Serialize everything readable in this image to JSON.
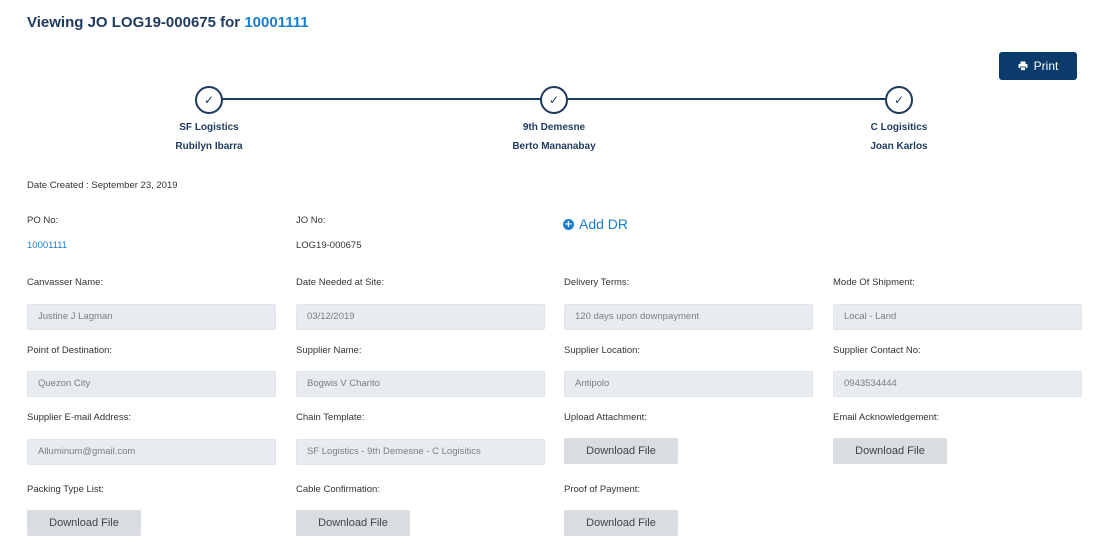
{
  "header": {
    "title_prefix": "Viewing JO LOG19-000675 for ",
    "title_po": "10001111",
    "print_label": "Print"
  },
  "chain": [
    {
      "company": "SF Logistics",
      "person": "Rubilyn Ibarra",
      "status_icon": "check-icon"
    },
    {
      "company": "9th Demesne",
      "person": "Berto Mananabay",
      "status_icon": "check-icon"
    },
    {
      "company": "C Logisitics",
      "person": "Joan Karlos",
      "status_icon": "check-icon"
    }
  ],
  "date_created": "Date Created : September 23, 2019",
  "po": {
    "label": "PO No:",
    "value": "10001111"
  },
  "jo": {
    "label": "JO No:",
    "value": "LOG19-000675"
  },
  "add_dr_label": "Add DR",
  "fields": {
    "canvasser": {
      "label": "Canvasser Name:",
      "value": "Justine J Lagman"
    },
    "date_needed": {
      "label": "Date Needed at Site:",
      "value": "03/12/2019"
    },
    "delivery_terms": {
      "label": "Delivery Terms:",
      "value": "120 days upon downpayment"
    },
    "mode_shipment": {
      "label": "Mode Of Shipment:",
      "value": "Local - Land"
    },
    "destination": {
      "label": "Point of Destination:",
      "value": "Quezon City"
    },
    "supplier_name": {
      "label": "Supplier Name:",
      "value": "Bogwis V Charito"
    },
    "supplier_location": {
      "label": "Supplier Location:",
      "value": "Antipolo"
    },
    "supplier_contact": {
      "label": "Supplier Contact No:",
      "value": "0943534444"
    },
    "supplier_email": {
      "label": "Supplier E-mail Address:",
      "value": "Alluminum@gmail.com"
    },
    "chain_template": {
      "label": "Chain Template:",
      "value": "SF Logistics - 9th Demesne - C Logisitics"
    },
    "upload_attachment": {
      "label": "Upload Attachment:",
      "button": "Download File"
    },
    "email_ack": {
      "label": "Email Acknowledgement:",
      "button": "Download File"
    },
    "packing_list": {
      "label": "Packing Type List:",
      "button": "Download File"
    },
    "cable_confirmation": {
      "label": "Cable Confirmation:",
      "button": "Download File"
    },
    "proof_payment": {
      "label": "Proof of Payment:",
      "button": "Download File"
    }
  },
  "colors": {
    "primary": "#0b3b6b",
    "heading": "#1d3a5e",
    "link": "#1a7fd4",
    "field_bg": "#e8ebef"
  }
}
